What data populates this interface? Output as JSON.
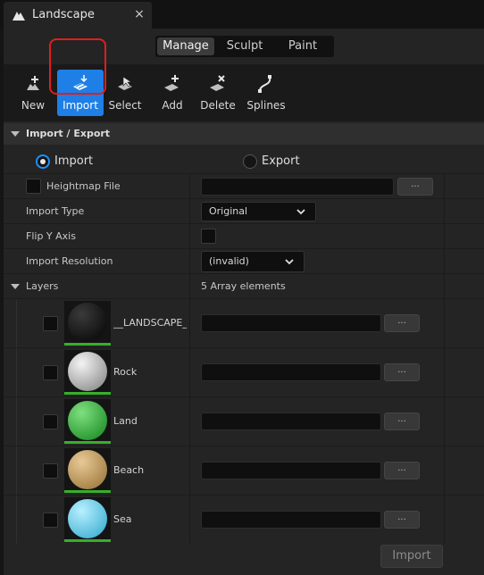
{
  "tab": {
    "title": "Landscape",
    "close": "×",
    "icon": "unreal-logo-icon"
  },
  "modes": [
    {
      "label": "Manage",
      "active": true
    },
    {
      "label": "Sculpt",
      "active": false
    },
    {
      "label": "Paint",
      "active": false
    }
  ],
  "toolbar": {
    "tools": [
      {
        "label": "New",
        "icon": "new-icon"
      },
      {
        "label": "Import",
        "icon": "import-icon",
        "selected": true
      },
      {
        "label": "Select",
        "icon": "select-icon"
      },
      {
        "label": "Add",
        "icon": "add-icon"
      },
      {
        "label": "Delete",
        "icon": "delete-icon"
      },
      {
        "label": "Splines",
        "icon": "splines-icon"
      }
    ]
  },
  "section": {
    "title": "Import / Export"
  },
  "radios": {
    "import": "Import",
    "export": "Export",
    "selected": "Import"
  },
  "props": {
    "heightmap_label": "Heightmap File",
    "heightmap_value": "",
    "browse": "...",
    "import_type_label": "Import Type",
    "import_type_value": "Original",
    "flip_label": "Flip Y Axis",
    "resolution_label": "Import Resolution",
    "resolution_value": "(invalid)"
  },
  "layers": {
    "label": "Layers",
    "count": "5 Array elements",
    "items": [
      {
        "name": "__LANDSCAPE_VISIBILITY__",
        "color": "#1a1a1a"
      },
      {
        "name": "Rock",
        "color": "#c9c9c9"
      },
      {
        "name": "Land",
        "color": "#3fb34a"
      },
      {
        "name": "Beach",
        "color": "#c7a46b"
      },
      {
        "name": "Sea",
        "color": "#6fd1ec"
      }
    ]
  },
  "import_button": "Import",
  "colors": {
    "accent": "#1e7fe6",
    "highlight": "#e11d1d",
    "layer_bar": "#36b02a"
  }
}
